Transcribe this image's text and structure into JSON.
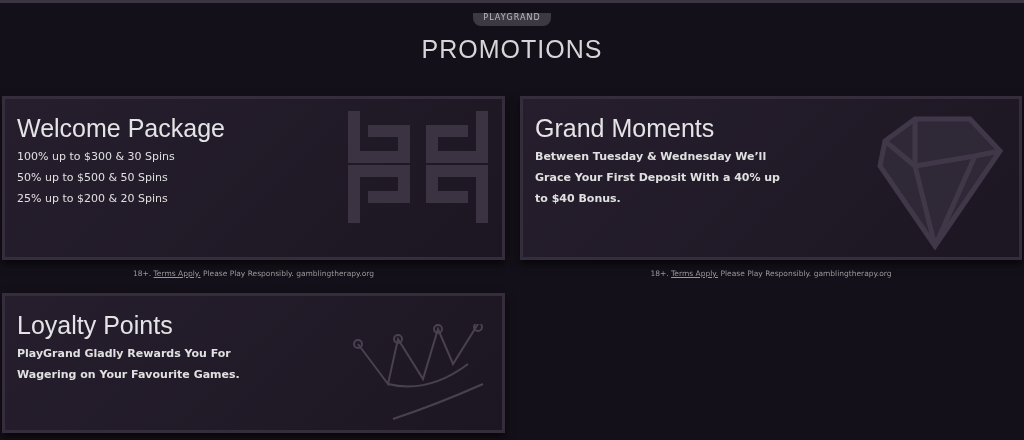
{
  "header": {
    "logo_tab": "PLAYGRAND",
    "title": "PROMOTIONS"
  },
  "promotions": [
    {
      "title": "Welcome Package",
      "kind": "letters",
      "lines": [
        "100% up to $300 & 30 Spins",
        "50% up to $500 & 50 Spins",
        "25% up to $200 & 20 Spins"
      ],
      "footer": {
        "prefix": "18+.",
        "link": "Terms Apply.",
        "suffix": "Please Play Responsibly. gamblingtherapy.org"
      }
    },
    {
      "title": "Grand Moments",
      "kind": "diamond",
      "text": "Between Tuesday & Wednesday We’ll Grace Your First Deposit With a 40% up to $40 Bonus.",
      "footer": {
        "prefix": "18+.",
        "link": "Terms Apply.",
        "suffix": "Please Play Responsibly. gamblingtherapy.org"
      }
    },
    {
      "title": "Loyalty Points",
      "kind": "crown",
      "text": "PlayGrand Gladly Rewards You For Wagering on Your Favourite Games."
    }
  ]
}
